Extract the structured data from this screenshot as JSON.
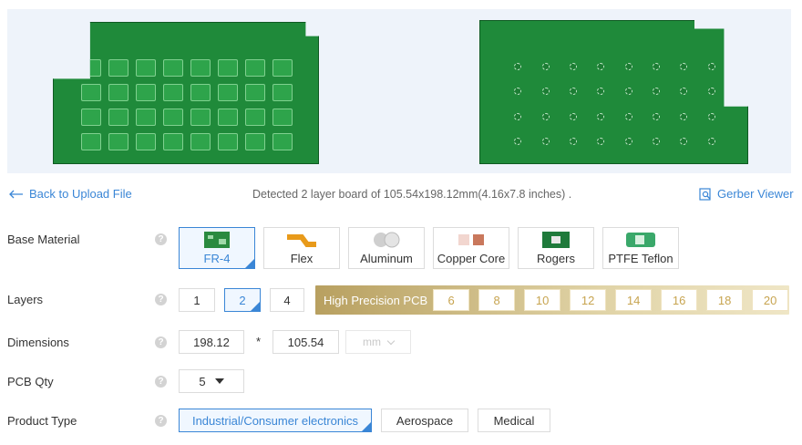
{
  "preview": {
    "top_board": "top-layer-render",
    "bottom_board": "bottom-layer-render"
  },
  "nav": {
    "back_label": "Back to Upload File",
    "detected_text": "Detected 2 layer board of 105.54x198.12mm(4.16x7.8 inches) .",
    "gerber_label": "Gerber Viewer"
  },
  "base_material": {
    "label": "Base Material",
    "options": [
      {
        "label": "FR-4",
        "icon": "fr4-board-icon",
        "selected": true
      },
      {
        "label": "Flex",
        "icon": "flex-cable-icon",
        "selected": false
      },
      {
        "label": "Aluminum",
        "icon": "aluminum-disc-icon",
        "selected": false
      },
      {
        "label": "Copper Core",
        "icon": "copper-core-icon",
        "selected": false
      },
      {
        "label": "Rogers",
        "icon": "rogers-board-icon",
        "selected": false
      },
      {
        "label": "PTFE Teflon",
        "icon": "ptfe-board-icon",
        "selected": false
      }
    ]
  },
  "layers": {
    "label": "Layers",
    "options": [
      "1",
      "2",
      "4"
    ],
    "selected": "2",
    "high_precision_label": "High Precision PCB",
    "high_precision_options": [
      "6",
      "8",
      "10",
      "12",
      "14",
      "16",
      "18",
      "20"
    ]
  },
  "dimensions": {
    "label": "Dimensions",
    "length": "198.12",
    "separator": "*",
    "width": "105.54",
    "unit": "mm"
  },
  "pcb_qty": {
    "label": "PCB Qty",
    "value": "5"
  },
  "product_type": {
    "label": "Product Type",
    "options": [
      {
        "label": "Industrial/Consumer electronics",
        "selected": true
      },
      {
        "label": "Aerospace",
        "selected": false
      },
      {
        "label": "Medical",
        "selected": false
      }
    ]
  },
  "colors": {
    "accent": "#3a86d6",
    "pcb_green": "#1f8a3a",
    "gold": "#c7a450"
  }
}
